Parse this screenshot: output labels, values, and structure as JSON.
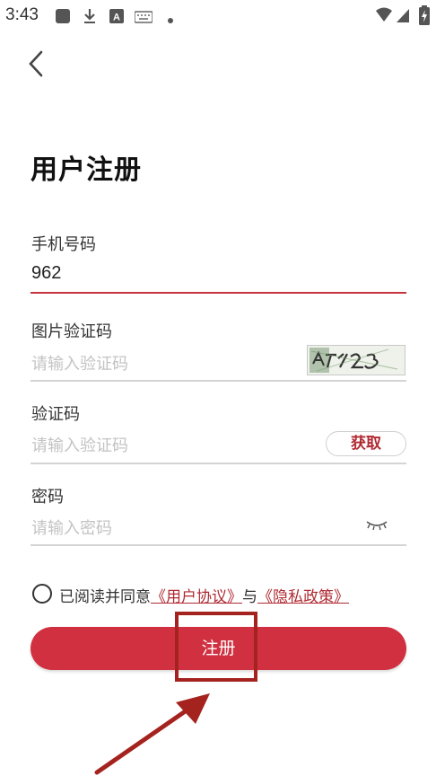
{
  "status_bar": {
    "time": "3:43"
  },
  "page": {
    "title": "用户注册"
  },
  "phone": {
    "label": "手机号码",
    "value": "962"
  },
  "image_captcha": {
    "label": "图片验证码",
    "placeholder": "请输入验证码",
    "captcha_text": "AT123"
  },
  "sms_code": {
    "label": "验证码",
    "placeholder": "请输入验证码",
    "get_button": "获取"
  },
  "password": {
    "label": "密码",
    "placeholder": "请输入密码"
  },
  "agreement": {
    "prefix": "已阅读并同意",
    "user_agreement": "《用户协议》",
    "connector": "与",
    "privacy_policy": "《隐私政策》"
  },
  "register_button": {
    "label": "注册"
  },
  "colors": {
    "accent": "#d03040",
    "link": "#b02a32",
    "annotation": "#a5231f"
  }
}
